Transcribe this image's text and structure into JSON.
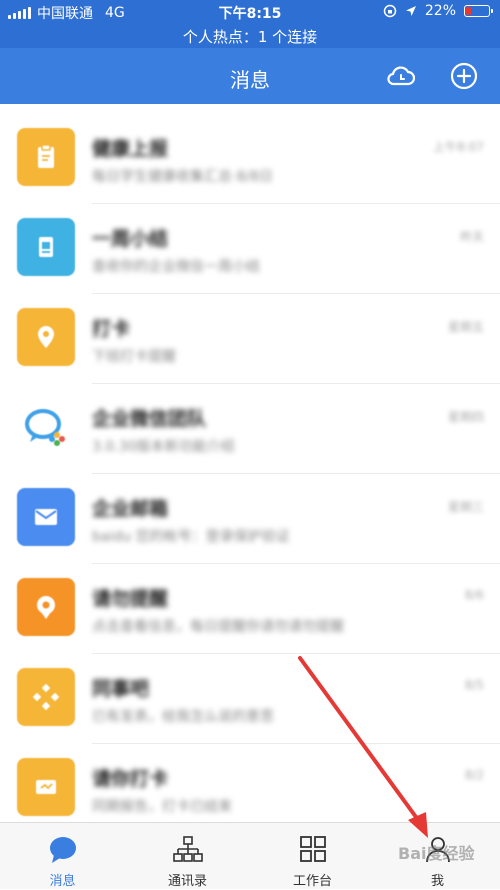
{
  "status_bar": {
    "carrier": "中国联通",
    "network": "4G",
    "time": "下午8:15",
    "battery": "22%",
    "battery_level": 0.22,
    "hotspot": "个人热点：1 个连接"
  },
  "nav": {
    "title": "消息",
    "cloud_icon": "cloud-icon",
    "add_icon": "plus-circle-icon"
  },
  "messages": [
    {
      "name": "健康上报",
      "preview": "每日学生健康收集汇总·8/8日",
      "time": "上午8:07",
      "color": "#f5b537",
      "icon": "clipboard-icon"
    },
    {
      "name": "一周小结",
      "preview": "查收你的企业微信一周小结",
      "time": "昨天",
      "color": "#3fb2e3",
      "icon": "report-icon"
    },
    {
      "name": "打卡",
      "preview": "下班打卡提醒",
      "time": "星期五",
      "color": "#f5b537",
      "icon": "location-icon"
    },
    {
      "name": "企业微信团队",
      "preview": "3.0.30版本新功能介绍",
      "time": "星期四",
      "color": "#ffffff",
      "icon": "wecom-logo-icon"
    },
    {
      "name": "企业邮箱",
      "preview": "baidu 您的帐号：登录保护验证",
      "time": "星期三",
      "color": "#4a8cf0",
      "icon": "mail-icon"
    },
    {
      "name": "请勿提醒",
      "preview": "点击查看信息，每日提醒你请勿请勿提醒",
      "time": "8/6",
      "color": "#f59327",
      "icon": "pin-icon"
    },
    {
      "name": "同事吧",
      "preview": "已有发表，给我怎么说的意思",
      "time": "8/5",
      "color": "#f5b537",
      "icon": "diamond-icon"
    },
    {
      "name": "请你打卡",
      "preview": "同期报告，打卡已结束",
      "time": "8/2",
      "color": "#f5b537",
      "icon": "check-card-icon"
    }
  ],
  "tabs": [
    {
      "label": "消息",
      "icon": "chat-bubble-icon",
      "active": true
    },
    {
      "label": "通讯录",
      "icon": "org-chart-icon",
      "active": false
    },
    {
      "label": "工作台",
      "icon": "grid-icon",
      "active": false
    },
    {
      "label": "我",
      "icon": "person-icon",
      "active": false
    }
  ],
  "watermark": "Bai度经验"
}
